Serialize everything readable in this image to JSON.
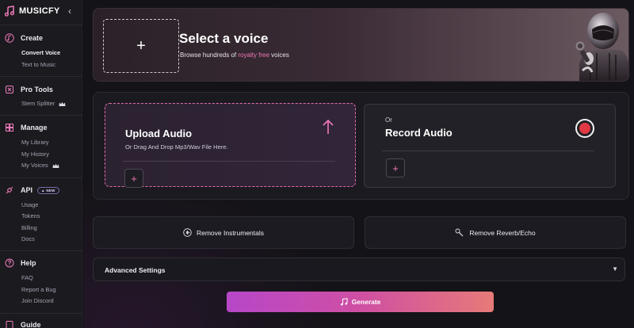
{
  "app": {
    "name": "MUSICFY",
    "collapse_icon": "chevron-left-icon",
    "accent": "#e26aa9"
  },
  "sidebar": {
    "sections": [
      {
        "title": "Create",
        "icon": "music-note-icon",
        "items": [
          "Convert Voice",
          "Text to Music"
        ],
        "active": "Convert Voice"
      },
      {
        "title": "Pro Tools",
        "icon": "tools-icon",
        "items": [
          "Stem Splitter"
        ],
        "crown_items": [
          "Stem Splitter"
        ]
      },
      {
        "title": "Manage",
        "icon": "library-icon",
        "items": [
          "My Library",
          "My History",
          "My Voices"
        ],
        "crown_items": [
          "My Voices"
        ]
      },
      {
        "title": "API",
        "icon": "api-icon",
        "badge": "NEW",
        "items": [
          "Usage",
          "Tokens",
          "Billing",
          "Docs"
        ]
      },
      {
        "title": "Help",
        "icon": "help-icon",
        "items": [
          "FAQ",
          "Report a Bug",
          "Join Discord"
        ]
      },
      {
        "title": "Guide",
        "icon": "guide-icon",
        "items": []
      }
    ]
  },
  "hero": {
    "plus": "+",
    "title": "Select a voice",
    "subtitle_before": "Browse hundreds of ",
    "subtitle_link": "royalty free",
    "subtitle_after": " voices"
  },
  "upload": {
    "title": "Upload Audio",
    "subtitle": "Or Drag And Drop Mp3/Wav File Here.",
    "plus": "+",
    "icon": "upload-arrow-icon"
  },
  "record": {
    "or": "Or",
    "title": "Record Audio",
    "plus": "+",
    "icon": "record-icon"
  },
  "tools": {
    "remove_instrumentals": "Remove Instrumentals",
    "remove_reverb": "Remove Reverb/Echo"
  },
  "advanced": {
    "label": "Advanced Settings",
    "chevron": "▼"
  },
  "generate": {
    "label": "Generate",
    "icon": "music-note-icon"
  }
}
